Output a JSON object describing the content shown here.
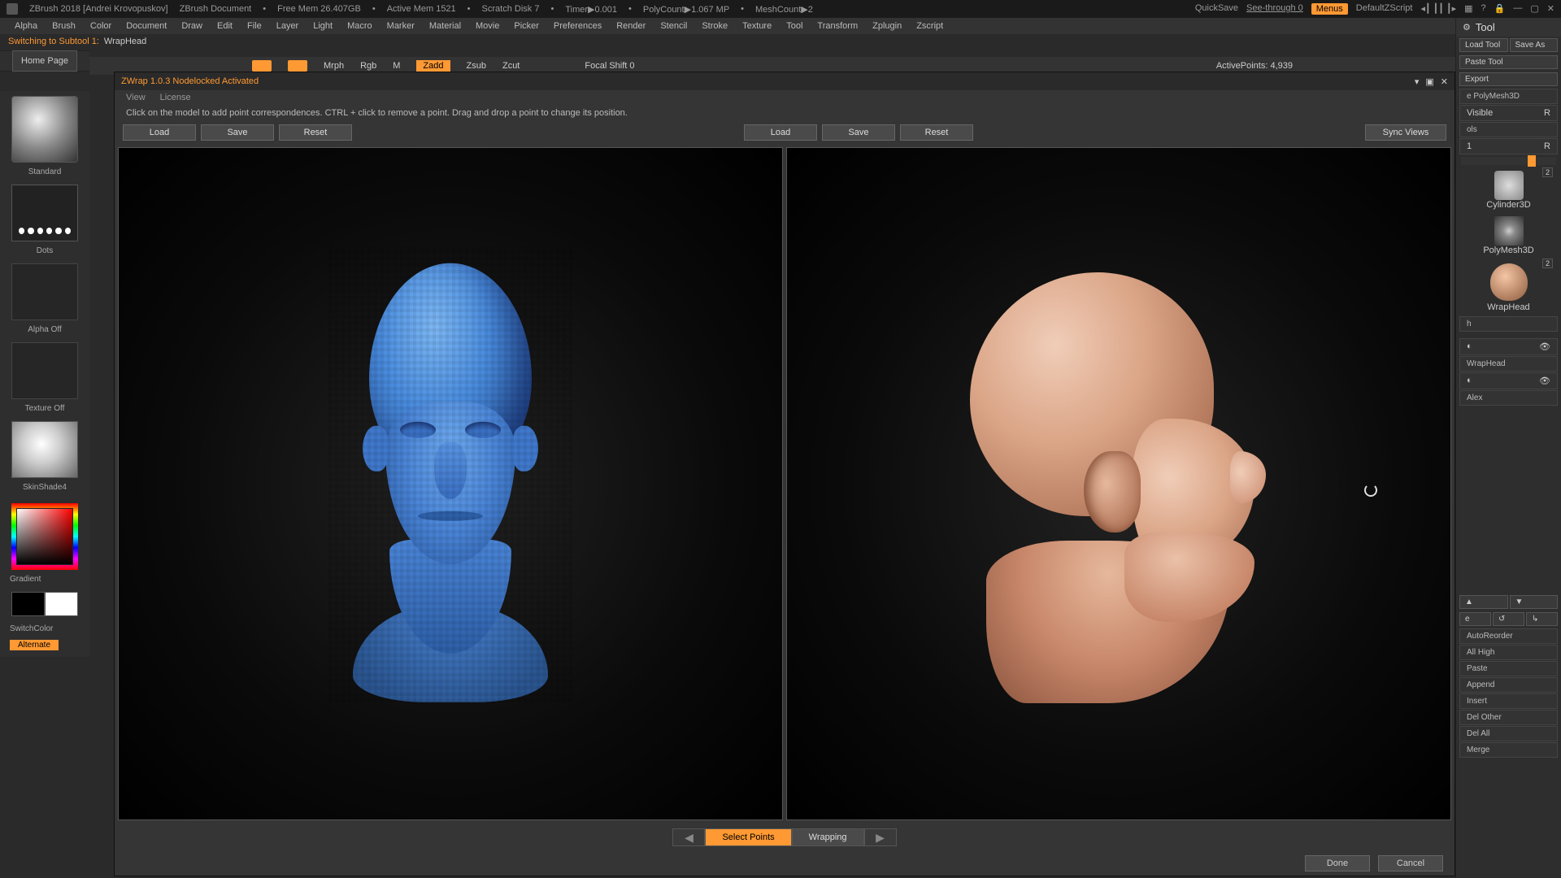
{
  "topbar": {
    "app": "ZBrush 2018 [Andrei Krovopuskov]",
    "doc": "ZBrush Document",
    "freemem": "Free Mem 26.407GB",
    "activemem": "Active Mem 1521",
    "scratch": "Scratch Disk 7",
    "timer": "Timer▶0.001",
    "polycount": "PolyCount▶1.067 MP",
    "meshcount": "MeshCount▶2",
    "quicksave": "QuickSave",
    "seethrough": "See-through  0",
    "menus": "Menus",
    "zscript": "DefaultZScript"
  },
  "menu": [
    "Alpha",
    "Brush",
    "Color",
    "Document",
    "Draw",
    "Edit",
    "File",
    "Layer",
    "Light",
    "Macro",
    "Marker",
    "Material",
    "Movie",
    "Picker",
    "Preferences",
    "Render",
    "Stencil",
    "Stroke",
    "Texture",
    "Tool",
    "Transform",
    "Zplugin",
    "Zscript"
  ],
  "subtool": {
    "label": "Switching to Subtool 1:",
    "value": "WrapHead"
  },
  "homepage": "Home Page",
  "hidden_strip": {
    "mrph": "Mrph",
    "rgb": "Rgb",
    "m": "M",
    "zadd": "Zadd",
    "zsub": "Zsub",
    "zcut": "Zcut",
    "focal": "Focal Shift 0",
    "active": "ActivePoints: 4,939"
  },
  "left": {
    "brush": "Standard",
    "stroke": "Dots",
    "alpha": "Alpha Off",
    "texture": "Texture Off",
    "material": "SkinShade4",
    "gradient": "Gradient",
    "switchcolor": "SwitchColor",
    "alternate": "Alternate"
  },
  "right": {
    "panel": "Tool",
    "loadtool": "Load Tool",
    "saveas": "Save As",
    "pastetool": "Paste Tool",
    "export": "Export",
    "polymesh": "e PolyMesh3D",
    "visible": "Visible",
    "r": "R",
    "ols": "ols",
    "one": "1",
    "two": "2",
    "cyl": "Cylinder3D",
    "pm3d": "PolyMesh3D",
    "wraphead": "WrapHead",
    "badge2": "2",
    "sel_name": "WrapHead",
    "alex": "Alex",
    "h": "h",
    "e": "e",
    "autoreorder": "AutoReorder",
    "allhigh": "All High",
    "paste": "Paste",
    "append": "Append",
    "insert": "Insert",
    "delother": "Del Other",
    "delall": "Del All",
    "merge": "Merge"
  },
  "plugin": {
    "title": "ZWrap 1.0.3  Nodelocked Activated",
    "menus": {
      "view": "View",
      "license": "License"
    },
    "hint": "Click on the model to add point correspondences. CTRL + click to remove a point. Drag and drop a point to change its position.",
    "load": "Load",
    "save": "Save",
    "reset": "Reset",
    "sync": "Sync Views",
    "select_points": "Select Points",
    "wrapping": "Wrapping",
    "done": "Done",
    "cancel": "Cancel"
  }
}
